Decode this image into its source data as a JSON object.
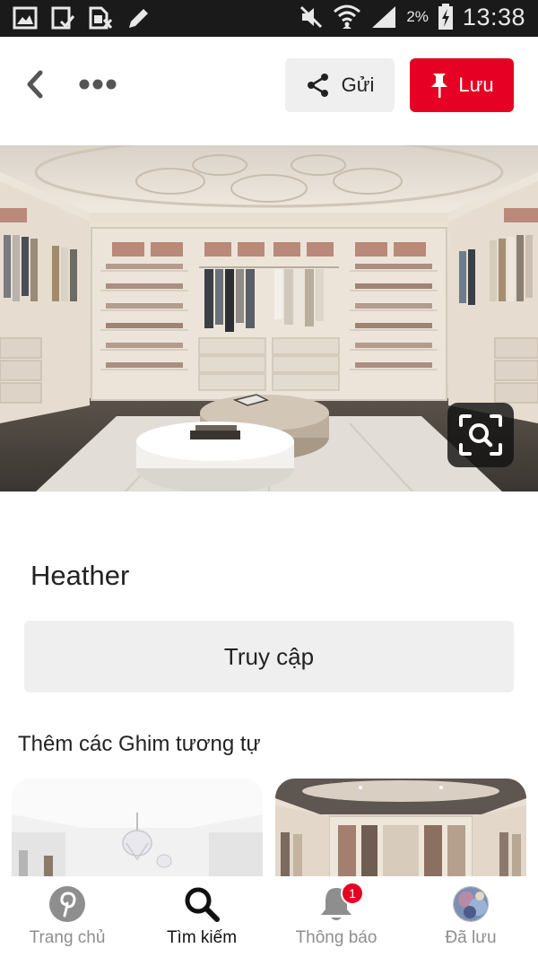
{
  "status_bar": {
    "battery_percent": "2%",
    "time": "13:38"
  },
  "header": {
    "send_label": "Gửi",
    "save_label": "Lưu"
  },
  "pin": {
    "title": "Heather",
    "visit_label": "Truy cập"
  },
  "more_like_this": {
    "heading": "Thêm các Ghim tương tự"
  },
  "bottom_nav": {
    "items": [
      {
        "label": "Trang chủ",
        "icon": "pinterest-logo-icon"
      },
      {
        "label": "Tìm kiếm",
        "icon": "search-icon"
      },
      {
        "label": "Thông báo",
        "icon": "bell-icon",
        "badge": "1"
      },
      {
        "label": "Đã lưu",
        "icon": "avatar"
      }
    ]
  },
  "colors": {
    "brand_red": "#e60023",
    "button_gray": "#efefef",
    "status_bar_bg": "#1a1a1a"
  }
}
